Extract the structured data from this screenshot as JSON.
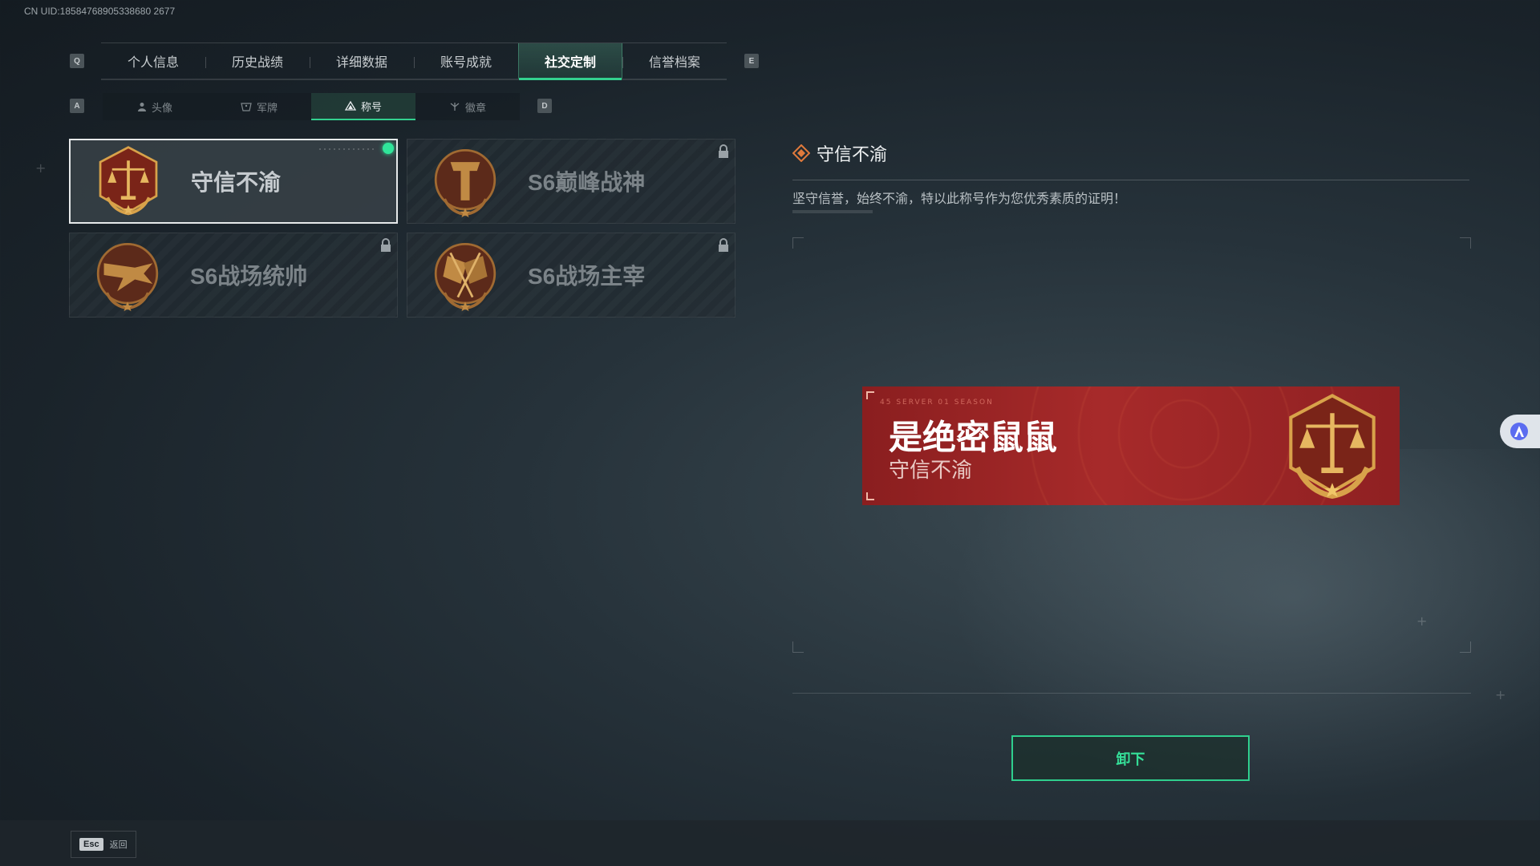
{
  "uid": "CN UID:18584768905338680 2677",
  "main_tabs": [
    {
      "label": "个人信息"
    },
    {
      "label": "历史战绩"
    },
    {
      "label": "详细数据"
    },
    {
      "label": "账号成就"
    },
    {
      "label": "社交定制"
    },
    {
      "label": "信誉档案"
    }
  ],
  "main_active_index": 4,
  "keys": {
    "prev_main": "Q",
    "next_main": "E",
    "prev_sub": "A",
    "next_sub": "D"
  },
  "sub_tabs": [
    {
      "label": "头像",
      "icon": "person-icon"
    },
    {
      "label": "军牌",
      "icon": "dogtag-icon"
    },
    {
      "label": "称号",
      "icon": "title-icon"
    },
    {
      "label": "徽章",
      "icon": "badge-icon"
    }
  ],
  "sub_active_index": 2,
  "titles": [
    {
      "label": "守信不渝",
      "emblem": "scales-emblem",
      "selected": true,
      "equipped": true,
      "locked": false
    },
    {
      "label": "S6巅峰战神",
      "emblem": "t-shield-emblem",
      "selected": false,
      "equipped": false,
      "locked": true
    },
    {
      "label": "S6战场统帅",
      "emblem": "jet-emblem",
      "selected": false,
      "equipped": false,
      "locked": true
    },
    {
      "label": "S6战场主宰",
      "emblem": "flags-emblem",
      "selected": false,
      "equipped": false,
      "locked": true
    }
  ],
  "detail": {
    "title": "守信不渝",
    "description": "坚守信誉，始终不渝，特以此称号作为您优秀素质的证明！"
  },
  "preview": {
    "code": "45 SERVER 01 SEASON",
    "player_name": "是绝密鼠鼠",
    "title": "守信不渝"
  },
  "unequip_label": "卸下",
  "esc": {
    "key": "Esc",
    "label": "返回"
  },
  "colors": {
    "accent_green": "#33d18f",
    "preview_red": "#a72a2a",
    "emblem_gold": "#d8a24a"
  }
}
